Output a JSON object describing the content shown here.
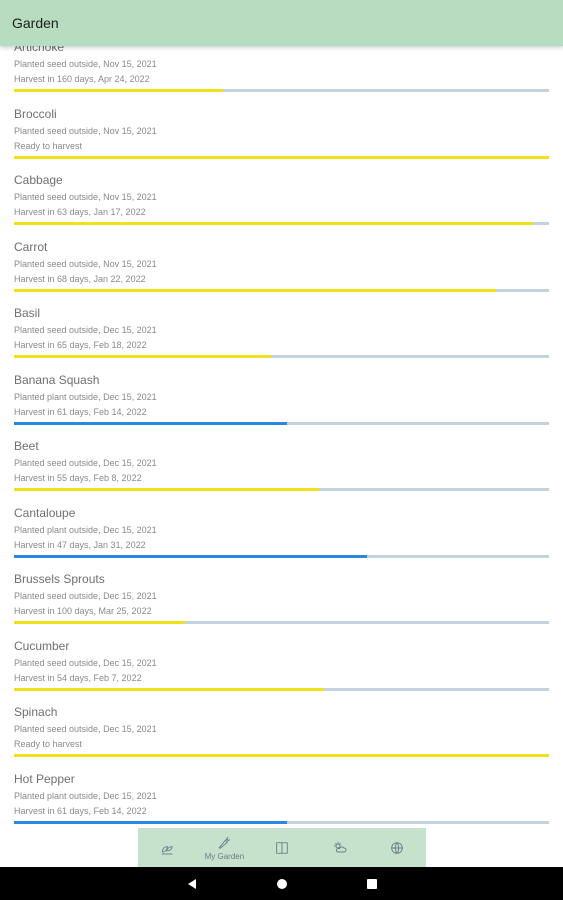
{
  "app": {
    "title": "Garden"
  },
  "colors": {
    "seed": "#f2e11a",
    "plant": "#2a88e0",
    "track": "#c2d2df",
    "appbar": "#b7dcbf",
    "nav": "#c6e2cc"
  },
  "items": [
    {
      "name": "Artichoke",
      "planted": "Planted seed outside, Nov 15, 2021",
      "harvest": "Harvest in 160 days, Apr 24, 2022",
      "progress": 0.39,
      "kind": "seed"
    },
    {
      "name": "Broccoli",
      "planted": "Planted seed outside, Nov 15, 2021",
      "harvest": "Ready to harvest",
      "progress": 1.0,
      "kind": "seed"
    },
    {
      "name": "Cabbage",
      "planted": "Planted seed outside, Nov 15, 2021",
      "harvest": "Harvest in 63 days, Jan 17, 2022",
      "progress": 0.97,
      "kind": "seed"
    },
    {
      "name": "Carrot",
      "planted": "Planted seed outside, Nov 15, 2021",
      "harvest": "Harvest in 68 days, Jan 22, 2022",
      "progress": 0.9,
      "kind": "seed"
    },
    {
      "name": "Basil",
      "planted": "Planted seed outside, Dec 15, 2021",
      "harvest": "Harvest in 65 days, Feb 18, 2022",
      "progress": 0.48,
      "kind": "seed"
    },
    {
      "name": "Banana Squash",
      "planted": "Planted plant outside, Dec 15, 2021",
      "harvest": "Harvest in 61 days, Feb 14, 2022",
      "progress": 0.51,
      "kind": "plant"
    },
    {
      "name": "Beet",
      "planted": "Planted seed outside, Dec 15, 2021",
      "harvest": "Harvest in 55 days, Feb 8, 2022",
      "progress": 0.57,
      "kind": "seed"
    },
    {
      "name": "Cantaloupe",
      "planted": "Planted plant outside, Dec 15, 2021",
      "harvest": "Harvest in 47 days, Jan 31, 2022",
      "progress": 0.66,
      "kind": "plant"
    },
    {
      "name": "Brussels Sprouts",
      "planted": "Planted seed outside, Dec 15, 2021",
      "harvest": "Harvest in 100 days, Mar 25, 2022",
      "progress": 0.32,
      "kind": "seed"
    },
    {
      "name": "Cucumber",
      "planted": "Planted seed outside, Dec 15, 2021",
      "harvest": "Harvest in 54 days, Feb 7, 2022",
      "progress": 0.58,
      "kind": "seed"
    },
    {
      "name": "Spinach",
      "planted": "Planted seed outside, Dec 15, 2021",
      "harvest": "Ready to harvest",
      "progress": 1.0,
      "kind": "seed"
    },
    {
      "name": "Hot Pepper",
      "planted": "Planted plant outside, Dec 15, 2021",
      "harvest": "Harvest in 61 days, Feb 14, 2022",
      "progress": 0.51,
      "kind": "plant"
    }
  ],
  "nav": [
    {
      "icon": "seedling-icon",
      "label": ""
    },
    {
      "icon": "carrot-icon",
      "label": "My Garden"
    },
    {
      "icon": "book-icon",
      "label": ""
    },
    {
      "icon": "weather-icon",
      "label": ""
    },
    {
      "icon": "globe-icon",
      "label": ""
    }
  ],
  "system_nav": [
    "back-icon",
    "home-icon",
    "recents-icon"
  ]
}
